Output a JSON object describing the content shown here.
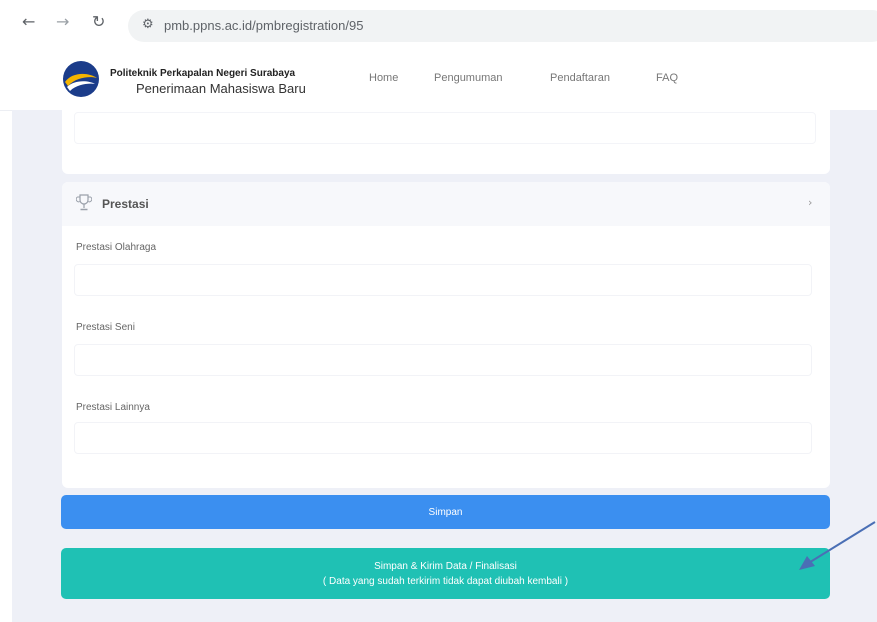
{
  "browser": {
    "url": "pmb.ppns.ac.id/pmbregistration/95",
    "back_icon": "←",
    "forward_icon": "→",
    "reload_icon": "↻",
    "tune_icon": "⚙"
  },
  "header": {
    "brand_line1": "Politeknik Perkapalan Negeri Surabaya",
    "brand_line2": "Penerimaan Mahasiswa Baru",
    "menu": [
      "Home",
      "Pengumuman",
      "Pendaftaran",
      "FAQ"
    ]
  },
  "section": {
    "title": "Prestasi",
    "chevron": "›",
    "fields": [
      {
        "label": "Prestasi Olahraga",
        "value": ""
      },
      {
        "label": "Prestasi Seni",
        "value": ""
      },
      {
        "label": "Prestasi Lainnya",
        "value": ""
      }
    ]
  },
  "actions": {
    "save_label": "Simpan",
    "finalize_line1": "Simpan & Kirim Data / Finalisasi",
    "finalize_line2": "( Data yang sudah terkirim tidak dapat diubah kembali )"
  },
  "colors": {
    "save_button": "#3b8ff0",
    "finalize_button": "#1fc1b4",
    "annotation_arrow": "#4a6fb5"
  }
}
